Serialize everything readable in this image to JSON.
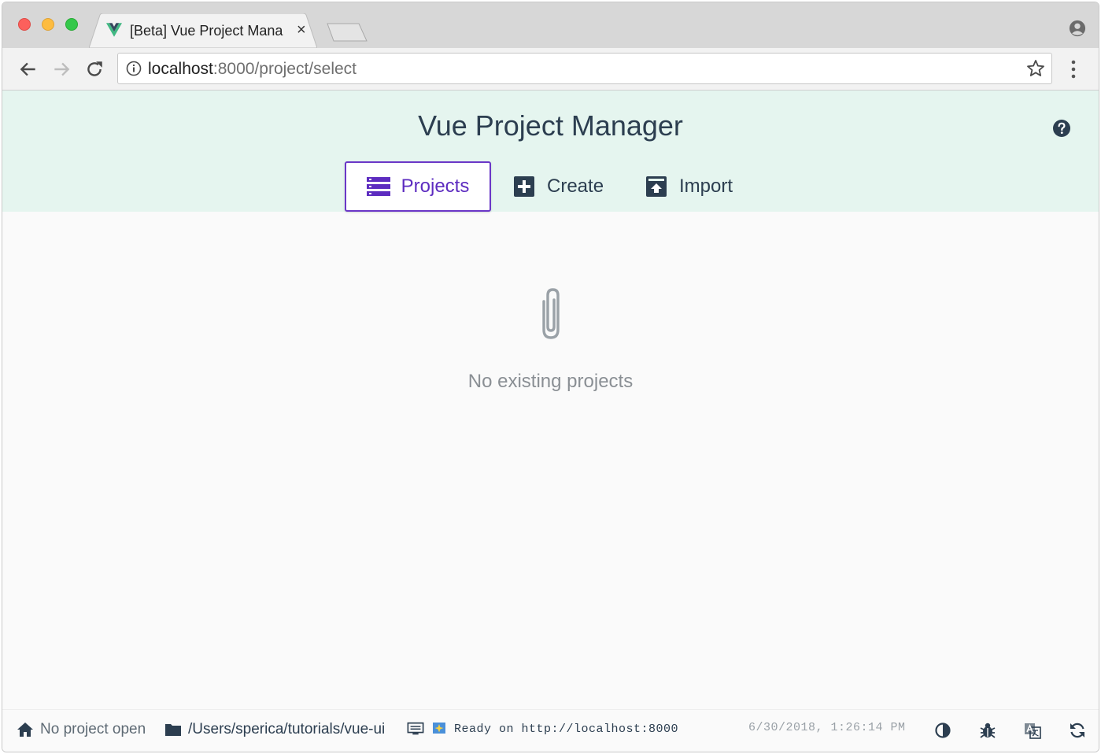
{
  "browser": {
    "tab": {
      "title": "[Beta] Vue Project Mana",
      "close_glyph": "×",
      "favicon": "vue-logo-icon"
    },
    "url": {
      "host": "localhost",
      "path": ":8000/project/select"
    }
  },
  "app": {
    "title": "Vue Project Manager",
    "nav": [
      {
        "label": "Projects",
        "icon": "list-icon",
        "active": true
      },
      {
        "label": "Create",
        "icon": "plus-box-icon",
        "active": false
      },
      {
        "label": "Import",
        "icon": "upload-box-icon",
        "active": false
      }
    ],
    "empty_state": {
      "icon": "paperclip-icon",
      "text": "No existing projects"
    }
  },
  "statusbar": {
    "project": "No project open",
    "cwd": "/Users/sperica/tutorials/vue-ui",
    "log": "Ready on http://localhost:8000",
    "timestamp": "6/30/2018, 1:26:14 PM"
  },
  "colors": {
    "accent": "#6a37c7",
    "header_bg": "#e5f5ef",
    "text_dark": "#2c3e50"
  }
}
